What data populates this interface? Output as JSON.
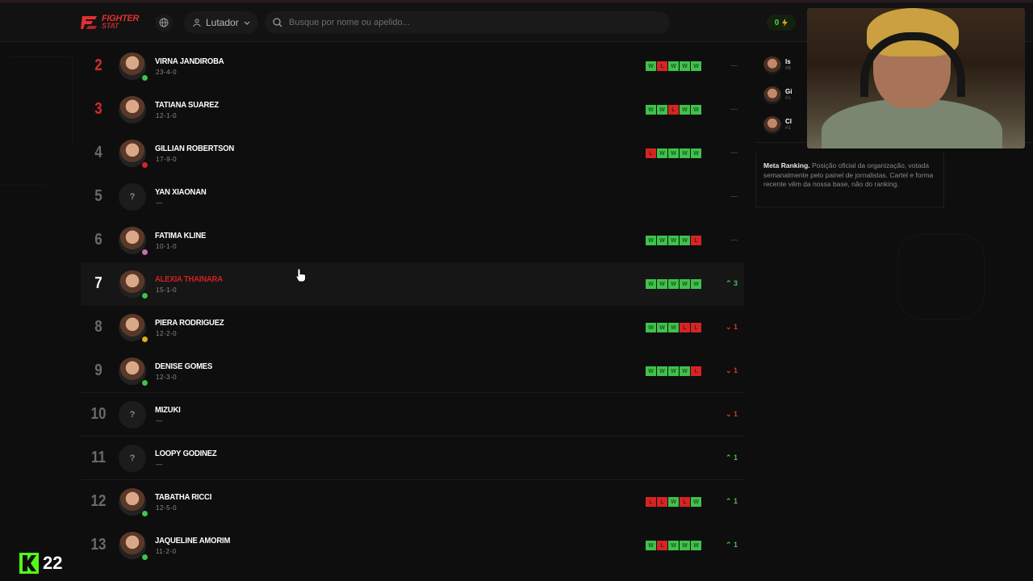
{
  "header": {
    "logo_line1": "FIGHTER",
    "logo_line2": "STAT",
    "role_select": "Lutador",
    "search_placeholder": "Busque por nome ou apelido...",
    "energy_count": "0"
  },
  "rankings": [
    {
      "rank": "2",
      "name": "VIRNA JANDIROBA",
      "record": "23-4-0",
      "form": [
        "W",
        "L",
        "W",
        "W",
        "W"
      ],
      "change": "—",
      "change_dir": "same",
      "flag": "#3fc24a"
    },
    {
      "rank": "3",
      "name": "TATIANA SUAREZ",
      "record": "12-1-0",
      "form": [
        "W",
        "W",
        "L",
        "W",
        "W"
      ],
      "change": "—",
      "change_dir": "same",
      "flag": ""
    },
    {
      "rank": "4",
      "name": "GILLIAN ROBERTSON",
      "record": "17-9-0",
      "form": [
        "L",
        "W",
        "W",
        "W",
        "W"
      ],
      "change": "—",
      "change_dir": "same",
      "flag": "#d62424"
    },
    {
      "rank": "5",
      "name": "YAN XIAONAN",
      "record": "—",
      "form": [],
      "change": "—",
      "change_dir": "same",
      "flag": ""
    },
    {
      "rank": "6",
      "name": "FATIMA KLINE",
      "record": "10-1-0",
      "form": [
        "W",
        "W",
        "W",
        "W",
        "L"
      ],
      "change": "—",
      "change_dir": "same",
      "flag": "#c870a8"
    },
    {
      "rank": "7",
      "name": "ALEXIA THAINARA",
      "record": "15-1-0",
      "form": [
        "W",
        "W",
        "W",
        "W",
        "W"
      ],
      "change": "3",
      "change_dir": "up",
      "flag": "#3fc24a"
    },
    {
      "rank": "8",
      "name": "PIERA RODRIGUEZ",
      "record": "12-2-0",
      "form": [
        "W",
        "W",
        "W",
        "L",
        "L"
      ],
      "change": "1",
      "change_dir": "down",
      "flag": "#d8b020"
    },
    {
      "rank": "9",
      "name": "DENISE GOMES",
      "record": "12-3-0",
      "form": [
        "W",
        "W",
        "W",
        "W",
        "L"
      ],
      "change": "1",
      "change_dir": "down",
      "flag": "#3fc24a"
    },
    {
      "rank": "10",
      "name": "MIZUKI",
      "record": "—",
      "form": [],
      "change": "1",
      "change_dir": "down",
      "flag": ""
    },
    {
      "rank": "11",
      "name": "LOOPY GODINEZ",
      "record": "—",
      "form": [],
      "change": "1",
      "change_dir": "up",
      "flag": ""
    },
    {
      "rank": "12",
      "name": "TABATHA RICCI",
      "record": "12-5-0",
      "form": [
        "L",
        "L",
        "W",
        "L",
        "W"
      ],
      "change": "1",
      "change_dir": "up",
      "flag": "#3fc24a"
    },
    {
      "rank": "13",
      "name": "JAQUELINE AMORIM",
      "record": "11-2-0",
      "form": [
        "W",
        "L",
        "W",
        "W",
        "W"
      ],
      "change": "1",
      "change_dir": "up",
      "flag": "#3fc24a"
    }
  ],
  "unknown_avatar": "?",
  "side": {
    "items": [
      {
        "name": "Is",
        "sub": "#9"
      },
      {
        "name": "Gi",
        "sub": "#1"
      },
      {
        "name": "Cl",
        "sub": "#1"
      }
    ],
    "note_title": "Meta Ranking.",
    "note_text": "Posição oficial da organização, votada semanalmente pelo painel de jornalistas. Cartel e forma recente vêm da nossa base, não do ranking."
  },
  "stream": {
    "kick_count": "22"
  },
  "colors": {
    "win": "#3fc24a",
    "loss": "#d62424",
    "accent_red": "#d62c2c",
    "kick_green": "#53fc18"
  },
  "icons": [
    "globe-icon",
    "user-icon",
    "chevron-down-icon",
    "search-icon",
    "bolt-icon",
    "cursor-icon",
    "kick-logo-icon"
  ]
}
